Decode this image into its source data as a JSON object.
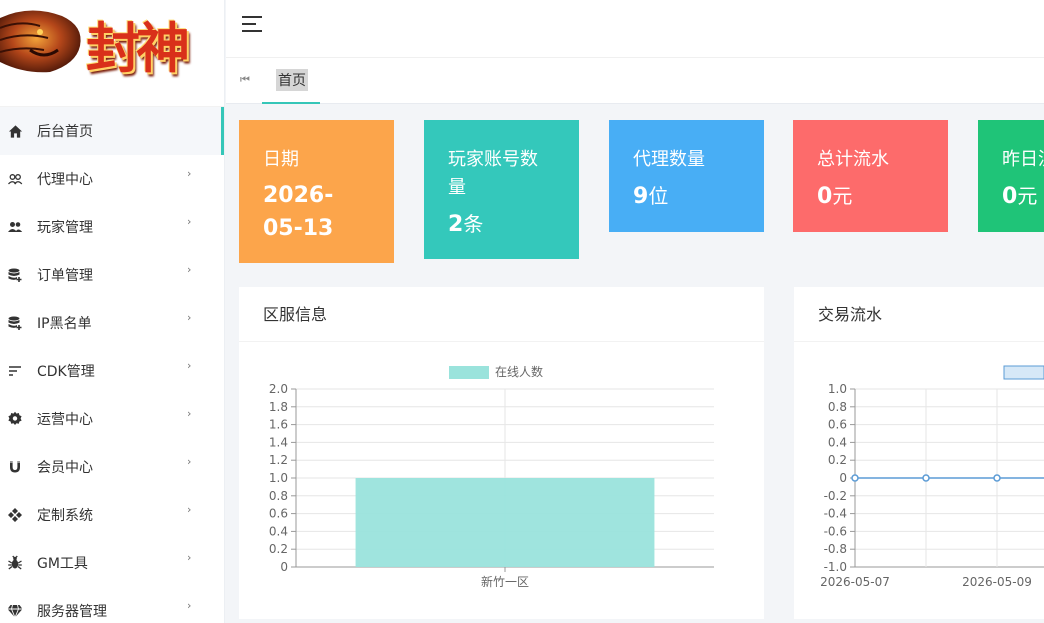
{
  "brand": {
    "logo_text": "封神"
  },
  "sidebar": {
    "items": [
      {
        "label": "后台首页",
        "icon": "home-icon",
        "active": true,
        "has_children": false
      },
      {
        "label": "代理中心",
        "icon": "users-outline-icon",
        "has_children": true
      },
      {
        "label": "玩家管理",
        "icon": "users-icon",
        "has_children": true
      },
      {
        "label": "订单管理",
        "icon": "database-add-icon",
        "has_children": true
      },
      {
        "label": "IP黑名单",
        "icon": "database-add-icon",
        "has_children": true
      },
      {
        "label": "CDK管理",
        "icon": "sort-lines-icon",
        "has_children": true
      },
      {
        "label": "运营中心",
        "icon": "gear-icon",
        "has_children": true
      },
      {
        "label": "会员中心",
        "icon": "magnet-icon",
        "has_children": true
      },
      {
        "label": "定制系统",
        "icon": "diamond-grid-icon",
        "has_children": true
      },
      {
        "label": "GM工具",
        "icon": "bug-icon",
        "has_children": true
      },
      {
        "label": "服务器管理",
        "icon": "gem-icon",
        "has_children": true
      }
    ],
    "arrow": "›"
  },
  "tabs": {
    "back_glyph": "⏮",
    "items": [
      {
        "label": "首页",
        "active": true
      }
    ]
  },
  "stats": [
    {
      "label": "日期",
      "value": "2026-05-13",
      "unit": "",
      "color": "#fca54b"
    },
    {
      "label": "玩家账号数量",
      "value": "2",
      "unit": "条",
      "color": "#34c8bb"
    },
    {
      "label": "代理数量",
      "value": "9",
      "unit": "位",
      "color": "#48aef5"
    },
    {
      "label": "总计流水",
      "value": "0",
      "unit": "元",
      "color": "#fd6b6b"
    },
    {
      "label": "昨日流水",
      "value": "0",
      "unit": "元",
      "color": "#1fc478"
    }
  ],
  "panels": [
    {
      "title": "区服信息"
    },
    {
      "title": "交易流水"
    }
  ],
  "chart_data": [
    {
      "type": "bar",
      "categories": [
        "新竹一区"
      ],
      "series": [
        {
          "name": "在线人数",
          "values": [
            1.0
          ],
          "color": "#9ae3dc"
        }
      ],
      "yticks": [
        "2.0",
        "1.8",
        "1.6",
        "1.4",
        "1.2",
        "1.0",
        "0.8",
        "0.6",
        "0.4",
        "0.2",
        "0"
      ],
      "ylim": [
        0,
        2
      ],
      "grid": true,
      "legend": "top-center"
    },
    {
      "type": "line",
      "x": [
        "2026-05-07",
        "2026-05-08",
        "2026-05-09"
      ],
      "xticks": [
        "2026-05-07",
        "2026-05-09"
      ],
      "series": [
        {
          "values": [
            0,
            0,
            0
          ],
          "color": "#5b9bd5"
        }
      ],
      "yticks": [
        "1.0",
        "0.8",
        "0.6",
        "0.4",
        "0.2",
        "0",
        "-0.2",
        "-0.4",
        "-0.6",
        "-0.8",
        "-1.0"
      ],
      "ylim": [
        -1,
        1
      ],
      "grid": true,
      "legend": "top-center"
    }
  ]
}
